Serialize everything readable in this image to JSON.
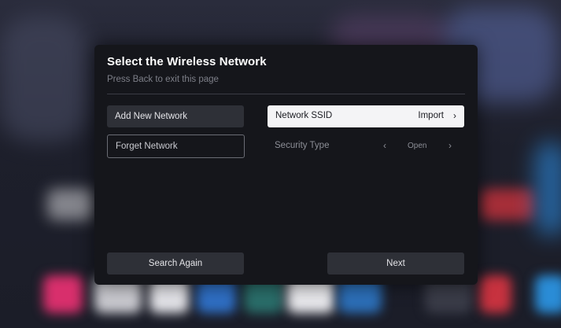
{
  "dialog": {
    "title": "Select the Wireless Network",
    "subtitle": "Press Back to exit this page"
  },
  "left_panel": {
    "add_network_label": "Add New Network",
    "forget_network_label": "Forget Network"
  },
  "right_panel": {
    "ssid": {
      "label": "Network SSID",
      "value": "Import",
      "chevron": "›"
    },
    "security": {
      "label": "Security Type",
      "prev": "‹",
      "value": "Open",
      "next": "›"
    }
  },
  "footer": {
    "search_again_label": "Search Again",
    "next_label": "Next"
  },
  "colors": {
    "dialog_bg": "#15161b",
    "button_bg": "#2e3037",
    "focused_bg": "#f4f4f6"
  }
}
